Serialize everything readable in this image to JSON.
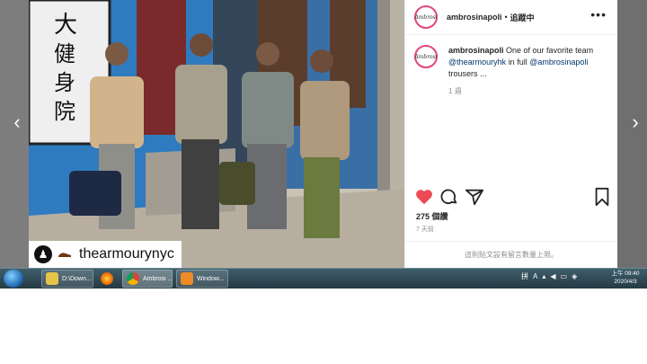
{
  "post": {
    "username": "ambrosinapoli",
    "separator": "•",
    "follow_label": "追蹤中",
    "avatar_text": "Ambrosi",
    "caption_user": "ambrosinapoli",
    "caption_part1": "One of our favorite team",
    "caption_mention1": "@thearmouryhk",
    "caption_part2": "in full",
    "caption_mention2": "@ambrosinapoli",
    "caption_part3": "trousers ...",
    "caption_time": "1 週",
    "likes": "275 個讚",
    "posted_ago": "7 天前",
    "comments_disabled": "這則貼文設有留言數量上限。"
  },
  "photo": {
    "tag_username": "thearmourynyc",
    "sign_text": "健身院",
    "sign_partial": "大"
  },
  "icons": {
    "heart": "heart-icon",
    "comment": "comment-icon",
    "share": "paper-plane-icon",
    "save": "bookmark-icon",
    "more": "more-icon",
    "prev": "chevron-left-icon",
    "next": "chevron-right-icon"
  },
  "colors": {
    "like": "#ed4956",
    "avatar_ring": "#e14875",
    "mention": "#00376b",
    "taskbar": "#2e4752"
  },
  "taskbar": {
    "items": [
      {
        "label": "D:\\Down...",
        "icon": "folder-icon"
      },
      {
        "label": "",
        "icon": "firefox-icon"
      },
      {
        "label": "Ambrosi ...",
        "icon": "chrome-icon"
      },
      {
        "label": "Window...",
        "icon": "media-player-icon"
      }
    ],
    "tray": {
      "lang": "A",
      "ime": "拼"
    },
    "clock_time": "上午 09:40",
    "clock_date": "2020/4/3"
  }
}
